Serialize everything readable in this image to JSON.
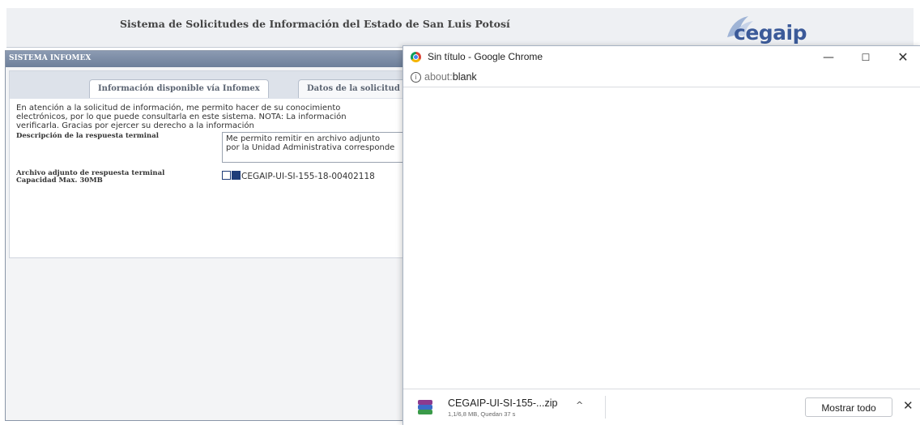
{
  "site": {
    "title": "Sistema de Solicitudes de Información del Estado de San Luis Potosí",
    "logo_text": "cegaip"
  },
  "panel": {
    "title": "SISTEMA INFOMEX",
    "tabs": [
      {
        "label": "Información disponible vía Infomex"
      },
      {
        "label": "Datos de la solicitud"
      }
    ],
    "intro_lines": [
      "En atención a la solicitud de información, me permito hacer de su conocimiento",
      "electrónicos, por lo que puede consultarla en este sistema. NOTA: La información",
      "verificarla. Gracias por ejercer su derecho a la información"
    ],
    "desc_label": "Descripción de la respuesta terminal",
    "desc_lines": [
      "Me permito remitir en archivo adjunto",
      "por la Unidad Administrativa corresponde"
    ],
    "attach_label_line1": "Archivo adjunto de respuesta terminal",
    "attach_label_line2": "Capacidad Max. 30MB",
    "attach_file": "CEGAIP-UI-SI-155-18-00402118"
  },
  "chrome_window": {
    "title": "Sin título - Google Chrome",
    "url_prefix": "about:",
    "url_rest": "blank",
    "controls": {
      "minimize": "—",
      "maximize": "☐",
      "close": "✕"
    }
  },
  "download_shelf": {
    "file_name": "CEGAIP-UI-SI-155-...zip",
    "status": "1,1/6,8 MB, Quedan 37 s",
    "chevron": "^",
    "show_all_label": "Mostrar todo",
    "close": "✕"
  },
  "icons": {
    "zip_icon": "winrar-archive-icon",
    "info_icon": "info-icon",
    "chrome_icon": "chrome-logo-icon"
  }
}
